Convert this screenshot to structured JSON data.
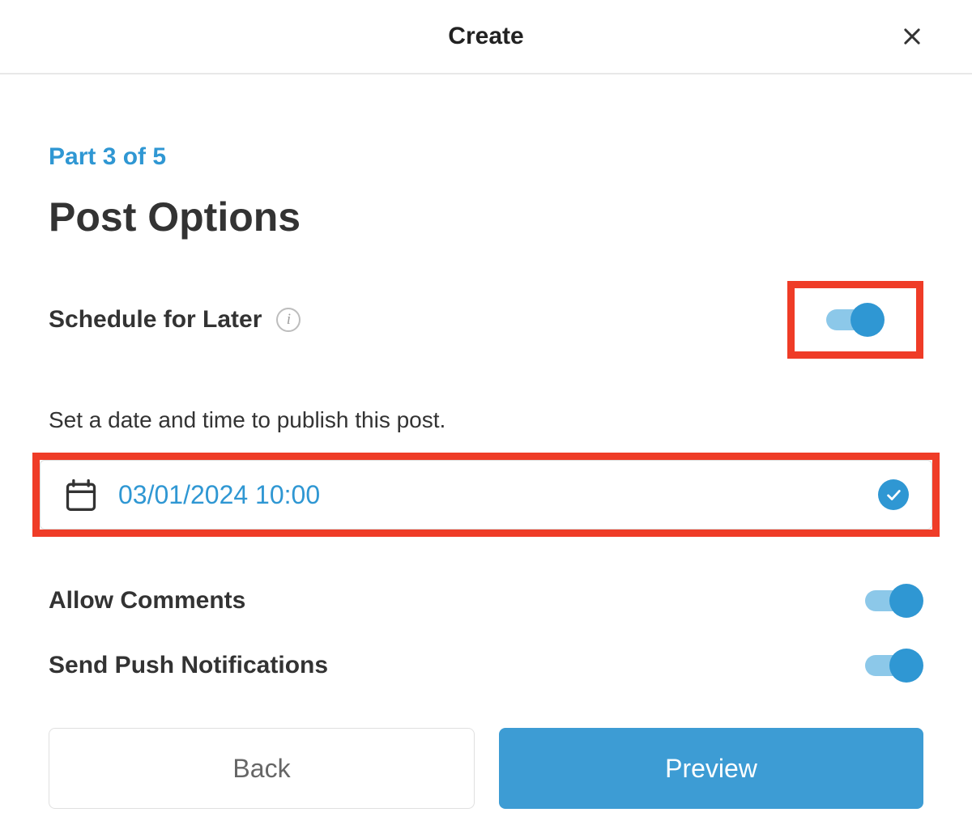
{
  "header": {
    "title": "Create"
  },
  "main": {
    "step_label": "Part 3 of 5",
    "title": "Post Options",
    "schedule": {
      "label": "Schedule for Later",
      "description": "Set a date and time to publish this post.",
      "value": "03/01/2024 10:00",
      "enabled": true
    },
    "allow_comments": {
      "label": "Allow Comments",
      "enabled": true
    },
    "push_notifications": {
      "label": "Send Push Notifications",
      "enabled": true
    },
    "buttons": {
      "back": "Back",
      "preview": "Preview"
    }
  },
  "colors": {
    "accent": "#2f97d3",
    "highlight": "#ef3c27"
  }
}
